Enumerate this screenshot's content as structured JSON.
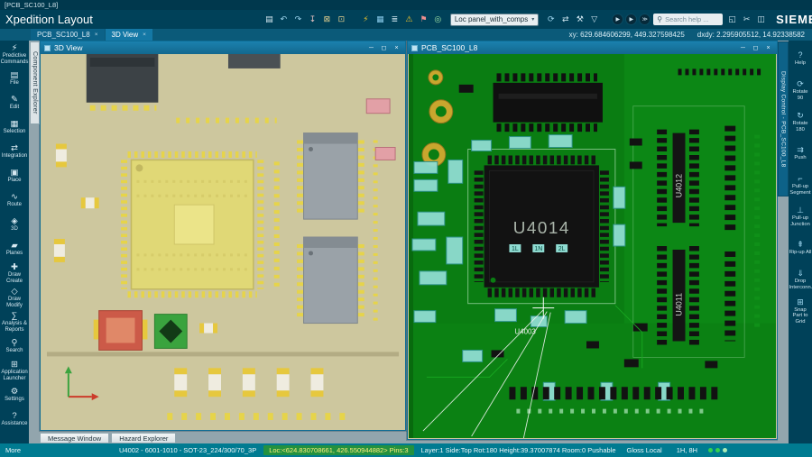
{
  "titlebar": {
    "doc_title": "[PCB_SC100_L8]"
  },
  "appbar": {
    "app_title": "Xpedition Layout",
    "brand": "SIEMENS",
    "dropdown_value": "Loc panel_with_comps",
    "dropdown_caret": "▾",
    "search_glyph": "⚲",
    "search_placeholder": "Search help ...",
    "icons_file": [
      {
        "name": "save-button",
        "icon": "save-icon",
        "glyph": "▤",
        "style": "color:#d9ebf3"
      },
      {
        "name": "undo-button",
        "icon": "undo-icon",
        "glyph": "↶",
        "style": "color:#9ed7f0"
      },
      {
        "name": "redo-button",
        "icon": "redo-icon",
        "glyph": "↷",
        "style": "color:#9ed7f0"
      },
      {
        "name": "pin-button",
        "icon": "pin-icon",
        "glyph": "↧",
        "style": "color:#e9c2c2"
      },
      {
        "name": "lock-button",
        "icon": "lock-icon",
        "glyph": "⊠",
        "style": "color:#e3cf8e"
      },
      {
        "name": "unlock-button",
        "icon": "unlock-icon",
        "glyph": "⊡",
        "style": "color:#e3cf8e"
      }
    ],
    "icons_tools": [
      {
        "name": "highlight-button",
        "icon": "bolt-icon",
        "glyph": "⚡",
        "style": "color:#f4c62a"
      },
      {
        "name": "grid-button",
        "icon": "grid-icon",
        "glyph": "▦",
        "style": "color:#86c8e8"
      },
      {
        "name": "layers-button",
        "icon": "layers-icon",
        "glyph": "≣",
        "style": "color:#cfe6f0"
      },
      {
        "name": "drc-button",
        "icon": "warning-icon",
        "glyph": "⚠",
        "style": "color:#f4c62a"
      },
      {
        "name": "flag-button",
        "icon": "flag-icon",
        "glyph": "⚑",
        "style": "color:#ef8f8f"
      },
      {
        "name": "target-button",
        "icon": "target-icon",
        "glyph": "◎",
        "style": "color:#9fe3a5"
      }
    ],
    "icons_after": [
      {
        "name": "refresh-button",
        "icon": "refresh-icon",
        "glyph": "⟳",
        "style": "color:#9ed7f0"
      },
      {
        "name": "swap-button",
        "icon": "swap-icon",
        "glyph": "⇄",
        "style": "color:#cfe6f0"
      },
      {
        "name": "tools-button",
        "icon": "hammer-icon",
        "glyph": "⚒",
        "style": "color:#cfe6f0"
      },
      {
        "name": "filter-button",
        "icon": "filter-icon",
        "glyph": "▽",
        "style": "color:#cfe6f0"
      }
    ],
    "icons_run": [
      {
        "name": "run-button-1",
        "icon": "play-icon",
        "glyph": "▶"
      },
      {
        "name": "run-button-2",
        "icon": "play-icon",
        "glyph": "▶"
      },
      {
        "name": "run-button-3",
        "icon": "fast-forward-icon",
        "glyph": "≫"
      }
    ],
    "icons_window": [
      {
        "name": "cascade-button",
        "icon": "cascade-icon",
        "glyph": "◱",
        "style": "color:#cfe6f0"
      },
      {
        "name": "cut-button",
        "icon": "scissors-icon",
        "glyph": "✂",
        "style": "color:#cfe6f0"
      },
      {
        "name": "tile-button",
        "icon": "tile-icon",
        "glyph": "◫",
        "style": "color:#cfe6f0"
      }
    ]
  },
  "tabrow": {
    "tabs": [
      {
        "name": "tab-pcb-sc100-l8",
        "cls": "doc-tab",
        "label": "PCB_SC100_L8",
        "close": "×"
      },
      {
        "name": "tab-3d-view",
        "cls": "doc-tab active",
        "label": "3D View",
        "close": "×"
      }
    ],
    "xy": "xy: 629.684606299, 449.327598425",
    "dxdy": "dxdy: 2.295905512, 14.92338582"
  },
  "sidebar": {
    "component_explorer": "Component Explorer",
    "items": [
      {
        "name": "sidebar-item-predictive-commands",
        "icon": "predictive-commands-icon",
        "glyph": "⚡",
        "label": "Predictive Commands"
      },
      {
        "name": "sidebar-item-file",
        "icon": "file-icon",
        "glyph": "▤",
        "label": "File"
      },
      {
        "name": "sidebar-item-edit",
        "icon": "edit-icon",
        "glyph": "✎",
        "label": "Edit"
      },
      {
        "name": "sidebar-item-selection",
        "icon": "selection-icon",
        "glyph": "▦",
        "label": "Selection"
      },
      {
        "name": "sidebar-item-integration",
        "icon": "integration-icon",
        "glyph": "⇄",
        "label": "Integration"
      },
      {
        "name": "sidebar-item-place",
        "icon": "place-icon",
        "glyph": "▣",
        "label": "Place"
      },
      {
        "name": "sidebar-item-route",
        "icon": "route-icon",
        "glyph": "∿",
        "label": "Route"
      },
      {
        "name": "sidebar-item-3d",
        "icon": "cube-icon",
        "glyph": "◈",
        "label": "3D"
      },
      {
        "name": "sidebar-item-planes",
        "icon": "planes-icon",
        "glyph": "▰",
        "label": "Planes"
      },
      {
        "name": "sidebar-item-draw-create",
        "icon": "draw-create-icon",
        "glyph": "✚",
        "label": "Draw Create"
      },
      {
        "name": "sidebar-item-draw-modify",
        "icon": "draw-modify-icon",
        "glyph": "◇",
        "label": "Draw Modify"
      },
      {
        "name": "sidebar-item-analysis-reports",
        "icon": "analysis-reports-icon",
        "glyph": "∑",
        "label": "Analysis & Reports"
      },
      {
        "name": "sidebar-item-search",
        "icon": "search-icon",
        "glyph": "⚲",
        "label": "Search"
      },
      {
        "name": "sidebar-item-application-launcher",
        "icon": "application-launcher-icon",
        "glyph": "⊞",
        "label": "Application Launcher"
      },
      {
        "name": "sidebar-item-settings",
        "icon": "gear-icon",
        "glyph": "⚙",
        "label": "Settings"
      },
      {
        "name": "sidebar-item-assistance",
        "icon": "help-icon",
        "glyph": "?",
        "label": "Assistance"
      }
    ]
  },
  "display_control": {
    "title": "Display Control - PCB_SC100_L8",
    "items": [
      {
        "name": "panel-item-help",
        "icon": "help-icon",
        "glyph": "?",
        "label": "Help"
      },
      {
        "name": "panel-item-rotate-90",
        "icon": "rotate-90-icon",
        "glyph": "⟳",
        "label": "Rotate 90"
      },
      {
        "name": "panel-item-rotate-180",
        "icon": "rotate-180-icon",
        "glyph": "↻",
        "label": "Rotate 180"
      },
      {
        "name": "panel-item-push",
        "icon": "push-icon",
        "glyph": "⇉",
        "label": "Push"
      },
      {
        "name": "panel-item-pullup-segment",
        "icon": "pullup-segment-icon",
        "glyph": "⌐",
        "label": "Pull-up Segment"
      },
      {
        "name": "panel-item-pullup-junction",
        "icon": "pullup-junction-icon",
        "glyph": "⊥",
        "label": "Pull-up Junction"
      },
      {
        "name": "panel-item-ripup-all",
        "icon": "ripup-all-icon",
        "glyph": "⇞",
        "label": "Rip-up All"
      },
      {
        "name": "panel-item-drop-interconnect",
        "icon": "drop-interconnect-icon",
        "glyph": "⇓",
        "label": "Drop Interconn..."
      },
      {
        "name": "panel-item-snap-part-to-grid",
        "icon": "snap-grid-icon",
        "glyph": "⊞",
        "label": "Snap Part to Grid"
      }
    ]
  },
  "windows": {
    "controls": {
      "minimize": "─",
      "maximize": "◻",
      "close": "×"
    },
    "view3d": {
      "title": "3D View"
    },
    "pcb": {
      "title": "PCB_SC100_L8",
      "labels": {
        "u4014": "U4014",
        "u4012": "U4012",
        "u4011": "U4011",
        "u4003": "U4003",
        "m1": "1L",
        "m2": "1N",
        "m3": "2L"
      }
    }
  },
  "bottom_tabs": [
    {
      "name": "tab-message-window",
      "label": "Message Window"
    },
    {
      "name": "tab-hazard-explorer",
      "label": "Hazard Explorer"
    }
  ],
  "statusbar": {
    "more": "More",
    "part": "U4002 - 6001-1010 - SOT-23_224/300/70_3P",
    "loc": "Loc:<624.830708661, 426.550944882>  Pins:3",
    "layer": "Layer:1 Side:Top Rot:180 Height:39.37007874 Room:0  Pushable",
    "gloss": "Gloss Local",
    "mode": "1H, 8H"
  }
}
